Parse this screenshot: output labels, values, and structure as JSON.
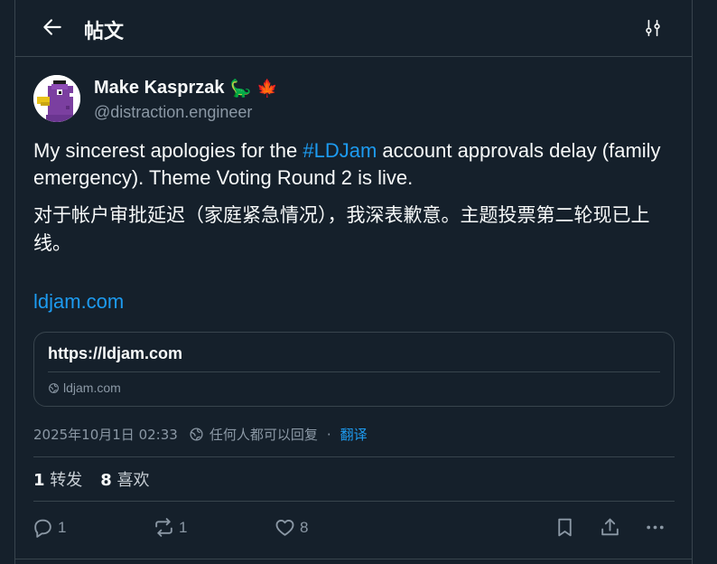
{
  "header": {
    "title": "帖文"
  },
  "author": {
    "display_name": "Make Kasprzak",
    "badges": [
      "🦕",
      "🍁"
    ],
    "handle": "@distraction.engineer"
  },
  "post": {
    "text_before": "My sincerest apologies for the ",
    "hashtag": "#LDJam",
    "text_after": " account approvals delay (family emergency). Theme Voting Round 2 is live.",
    "translation": "对于帐户审批延迟（家庭紧急情况），我深表歉意。主题投票第二轮现已上线。",
    "link": "ldjam.com"
  },
  "card": {
    "title": "https://ldjam.com",
    "domain": "ldjam.com"
  },
  "meta": {
    "timestamp": "2025年10月1日 02:33",
    "audience": "任何人都可以回复",
    "separator": "·",
    "translate": "翻译"
  },
  "stats": {
    "reposts_count": "1",
    "reposts_label": "转发",
    "likes_count": "8",
    "likes_label": "喜欢"
  },
  "actions": {
    "replies": "1",
    "reposts": "1",
    "likes": "8"
  },
  "colors": {
    "background": "#15202b",
    "border": "#38444d",
    "accent": "#1d9bf0",
    "muted": "#8b98a5"
  }
}
